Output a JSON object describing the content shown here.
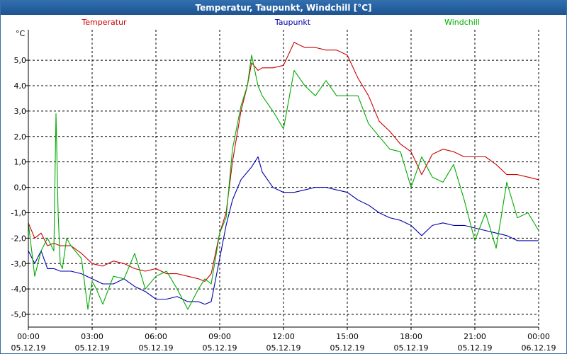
{
  "window": {
    "title": "Temperatur, Taupunkt, Windchill [°C]"
  },
  "chart_data": {
    "type": "line",
    "title": "Temperatur, Taupunkt, Windchill [°C]",
    "yunit": "°C",
    "ylim": [
      -5.5,
      6.2
    ],
    "y_ticks": [
      5.0,
      4.0,
      3.0,
      2.0,
      1.0,
      0.0,
      -1.0,
      -2.0,
      -3.0,
      -4.0,
      -5.0
    ],
    "y_tick_labels": [
      "5,0",
      "4,0",
      "3,0",
      "2,0",
      "1,0",
      "0,0",
      "-1,0",
      "-2,0",
      "-3,0",
      "-4,0",
      "-5,0"
    ],
    "xlim": [
      0,
      24
    ],
    "x_ticks": [
      0,
      3,
      6,
      9,
      12,
      15,
      18,
      21,
      24
    ],
    "x_tick_labels": [
      {
        "time": "00:00",
        "date": "05.12.19"
      },
      {
        "time": "03:00",
        "date": "05.12.19"
      },
      {
        "time": "06:00",
        "date": "05.12.19"
      },
      {
        "time": "09:00",
        "date": "05.12.19"
      },
      {
        "time": "12:00",
        "date": "05.12.19"
      },
      {
        "time": "15:00",
        "date": "05.12.19"
      },
      {
        "time": "18:00",
        "date": "05.12.19"
      },
      {
        "time": "21:00",
        "date": "05.12.19"
      },
      {
        "time": "00:00",
        "date": "06.12.19"
      }
    ],
    "grid": true,
    "legend_position": "top",
    "series": [
      {
        "name": "Temperatur",
        "color": "#cc0000",
        "x": [
          0,
          0.3,
          0.6,
          0.9,
          1.2,
          1.5,
          2.0,
          2.5,
          3.0,
          3.5,
          4.0,
          4.5,
          5.0,
          5.5,
          6.0,
          6.5,
          7.0,
          7.5,
          8.0,
          8.3,
          8.6,
          9.0,
          9.3,
          9.6,
          10.0,
          10.3,
          10.5,
          10.8,
          11.0,
          11.5,
          12.0,
          12.5,
          13.0,
          13.5,
          14.0,
          14.5,
          15.0,
          15.5,
          16.0,
          16.5,
          17.0,
          17.5,
          18.0,
          18.5,
          19.0,
          19.5,
          20.0,
          20.5,
          21.0,
          21.5,
          22.0,
          22.5,
          23.0,
          23.5,
          24.0
        ],
        "y": [
          -1.4,
          -2.0,
          -1.8,
          -2.3,
          -2.2,
          -2.3,
          -2.3,
          -2.6,
          -3.0,
          -3.1,
          -2.9,
          -3.0,
          -3.2,
          -3.3,
          -3.2,
          -3.4,
          -3.4,
          -3.5,
          -3.6,
          -3.7,
          -3.4,
          -1.8,
          -1.0,
          1.0,
          3.0,
          4.0,
          4.9,
          4.6,
          4.7,
          4.7,
          4.8,
          5.7,
          5.5,
          5.5,
          5.4,
          5.4,
          5.2,
          4.3,
          3.6,
          2.6,
          2.2,
          1.7,
          1.4,
          0.5,
          1.3,
          1.5,
          1.4,
          1.2,
          1.2,
          1.2,
          0.9,
          0.5,
          0.5,
          0.4,
          0.3
        ]
      },
      {
        "name": "Taupunkt",
        "color": "#0000aa",
        "x": [
          0,
          0.3,
          0.6,
          0.9,
          1.2,
          1.5,
          2.0,
          2.5,
          3.0,
          3.5,
          4.0,
          4.5,
          5.0,
          5.5,
          6.0,
          6.5,
          7.0,
          7.5,
          8.0,
          8.3,
          8.6,
          9.0,
          9.3,
          9.6,
          10.0,
          10.3,
          10.5,
          10.8,
          11.0,
          11.5,
          12.0,
          12.5,
          13.0,
          13.5,
          14.0,
          14.5,
          15.0,
          15.5,
          16.0,
          16.5,
          17.0,
          17.5,
          18.0,
          18.5,
          19.0,
          19.5,
          20.0,
          20.5,
          21.0,
          21.5,
          22.0,
          22.5,
          23.0,
          23.5,
          24.0
        ],
        "y": [
          -2.5,
          -3.0,
          -2.5,
          -3.2,
          -3.2,
          -3.3,
          -3.3,
          -3.4,
          -3.6,
          -3.8,
          -3.8,
          -3.6,
          -3.9,
          -4.1,
          -4.4,
          -4.4,
          -4.3,
          -4.5,
          -4.5,
          -4.6,
          -4.5,
          -2.8,
          -1.5,
          -0.5,
          0.3,
          0.6,
          0.8,
          1.2,
          0.6,
          0.0,
          -0.2,
          -0.2,
          -0.1,
          0.0,
          0.0,
          -0.1,
          -0.2,
          -0.5,
          -0.7,
          -1.0,
          -1.2,
          -1.3,
          -1.5,
          -1.9,
          -1.5,
          -1.4,
          -1.5,
          -1.5,
          -1.6,
          -1.7,
          -1.8,
          -1.9,
          -2.1,
          -2.1,
          -2.1
        ]
      },
      {
        "name": "Windchill",
        "color": "#00aa00",
        "x": [
          0,
          0.3,
          0.6,
          0.9,
          1.2,
          1.3,
          1.4,
          1.5,
          1.6,
          1.8,
          2.0,
          2.5,
          2.8,
          3.0,
          3.2,
          3.5,
          4.0,
          4.5,
          5.0,
          5.5,
          6.0,
          6.5,
          7.0,
          7.5,
          8.0,
          8.3,
          8.6,
          9.0,
          9.3,
          9.6,
          10.0,
          10.3,
          10.5,
          10.8,
          11.0,
          11.5,
          12.0,
          12.5,
          13.0,
          13.5,
          14.0,
          14.5,
          15.0,
          15.5,
          16.0,
          16.5,
          17.0,
          17.5,
          18.0,
          18.5,
          19.0,
          19.5,
          20.0,
          20.5,
          21.0,
          21.5,
          22.0,
          22.5,
          23.0,
          23.5,
          24.0
        ],
        "y": [
          -1.4,
          -3.5,
          -2.5,
          -2.0,
          -2.5,
          2.9,
          -1.0,
          -3.0,
          -3.2,
          -2.0,
          -2.3,
          -2.8,
          -4.8,
          -3.7,
          -4.0,
          -4.6,
          -3.5,
          -3.6,
          -2.6,
          -4.0,
          -3.5,
          -3.3,
          -4.0,
          -4.8,
          -4.0,
          -3.6,
          -3.8,
          -1.8,
          -1.2,
          1.5,
          3.2,
          4.0,
          5.2,
          4.0,
          3.6,
          3.0,
          2.3,
          4.6,
          4.0,
          3.6,
          4.2,
          3.6,
          3.6,
          3.6,
          2.5,
          2.0,
          1.5,
          1.4,
          0.0,
          1.2,
          0.4,
          0.2,
          0.9,
          -0.5,
          -2.1,
          -1.0,
          -2.4,
          0.2,
          -1.2,
          -1.0,
          -1.7
        ]
      }
    ]
  }
}
